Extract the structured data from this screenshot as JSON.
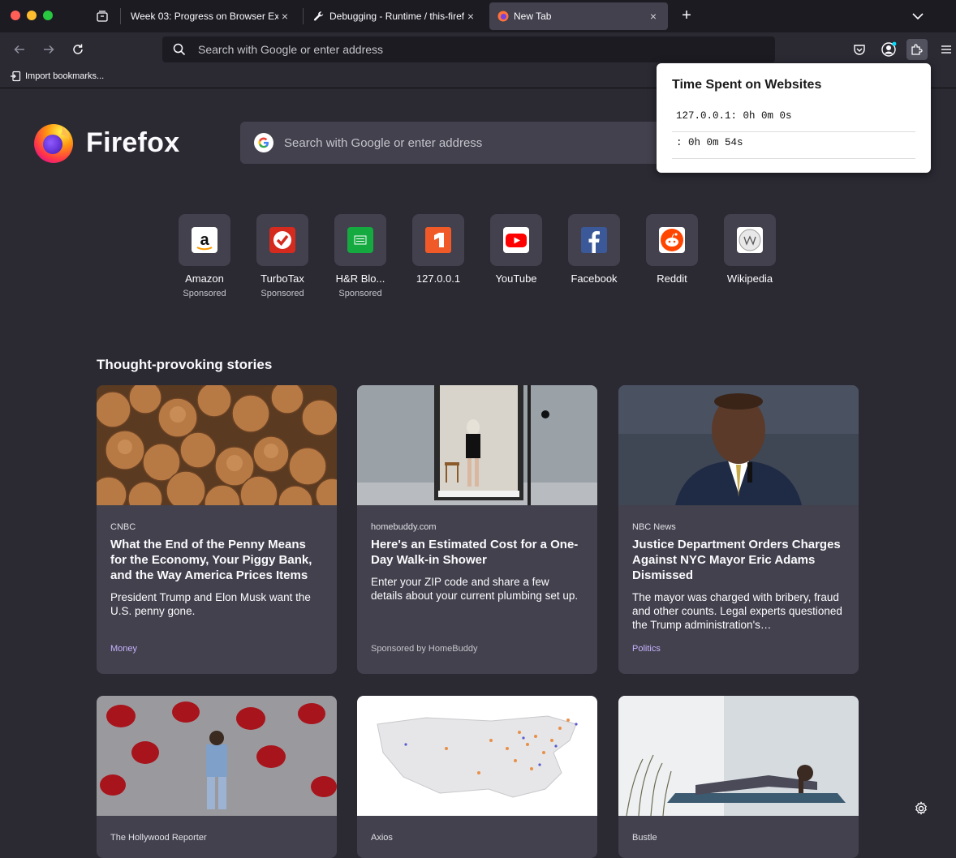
{
  "window": {
    "tabs": [
      {
        "title": "Week 03: Progress on Browser Exter",
        "close": "×"
      },
      {
        "title": "Debugging - Runtime / this-firef",
        "close": "×"
      },
      {
        "title": "New Tab",
        "close": "×"
      }
    ],
    "newtab_symbol": "+"
  },
  "toolbar": {
    "url_placeholder": "Search with Google or enter address"
  },
  "bookmarks": {
    "import_label": "Import bookmarks..."
  },
  "newtab": {
    "wordmark": "Firefox",
    "search_placeholder": "Search with Google or enter address",
    "tiles": [
      {
        "label": "Amazon",
        "sub": "Sponsored",
        "icon": "amazon-icon",
        "color": "#ffffff"
      },
      {
        "label": "TurboTax",
        "sub": "Sponsored",
        "icon": "turbotax-icon",
        "color": "#d52b1e"
      },
      {
        "label": "H&R Blo...",
        "sub": "Sponsored",
        "icon": "hrblock-icon",
        "color": "#14aa40"
      },
      {
        "label": "127.0.0.1",
        "sub": "",
        "icon": "letter-tile-icon",
        "color": "#f05a28"
      },
      {
        "label": "YouTube",
        "sub": "",
        "icon": "youtube-icon",
        "color": "#ff0000"
      },
      {
        "label": "Facebook",
        "sub": "",
        "icon": "facebook-icon",
        "color": "#1877f2"
      },
      {
        "label": "Reddit",
        "sub": "",
        "icon": "reddit-icon",
        "color": "#ff4500"
      },
      {
        "label": "Wikipedia",
        "sub": "",
        "icon": "wikipedia-icon",
        "color": "#ffffff"
      }
    ],
    "stories_heading": "Thought-provoking stories",
    "stories": [
      {
        "source": "CNBC",
        "title": "What the End of the Penny Means for the Economy, Your Piggy Bank, and the Way America Prices Items",
        "excerpt": "President Trump and Elon Musk want the U.S. penny gone.",
        "tag": "Money"
      },
      {
        "source": "homebuddy.com",
        "title": "Here's an Estimated Cost for a One-Day Walk-in Shower",
        "excerpt": "Enter your ZIP code and share a few details about your current plumbing set up.",
        "tag": "Sponsored by HomeBuddy"
      },
      {
        "source": "NBC News",
        "title": "Justice Department Orders Charges Against NYC Mayor Eric Adams Dismissed",
        "excerpt": "The mayor was charged with bribery, fraud and other counts. Legal experts questioned the Trump administration's…",
        "tag": "Politics"
      },
      {
        "source": "The Hollywood Reporter",
        "title": "",
        "excerpt": "",
        "tag": ""
      },
      {
        "source": "Axios",
        "title": "",
        "excerpt": "",
        "tag": ""
      },
      {
        "source": "Bustle",
        "title": "",
        "excerpt": "",
        "tag": ""
      }
    ]
  },
  "popup": {
    "title": "Time Spent on Websites",
    "rows": [
      "127.0.0.1: 0h 0m 0s",
      ": 0h 0m 54s"
    ]
  }
}
